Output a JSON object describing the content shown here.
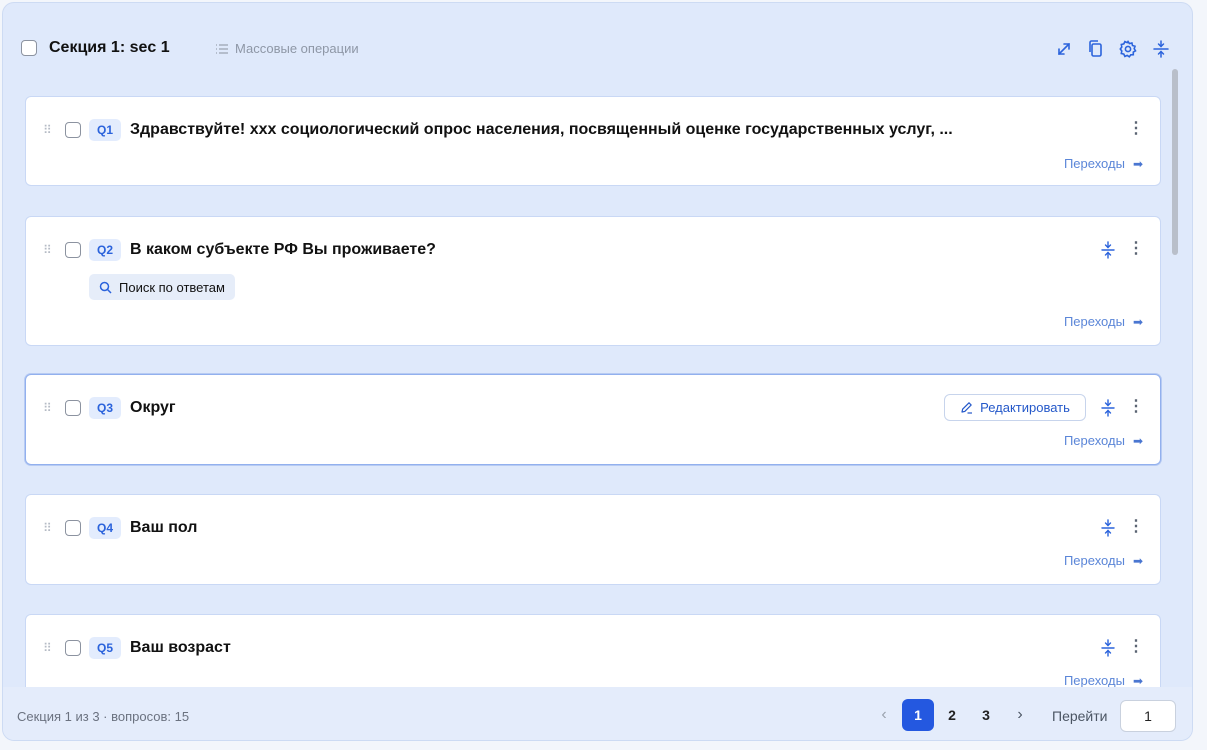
{
  "section": {
    "title": "Секция 1: sec 1",
    "bulk_label": "Массовые операции",
    "header_icons": [
      "expand-icon",
      "copy-icon",
      "settings-icon",
      "collapse-icon"
    ]
  },
  "questions": [
    {
      "tag": "Q1",
      "title": "Здравствуйте! ххх социологический опрос населения, посвященный оценке государственных услуг, ...",
      "transitions": "Переходы"
    },
    {
      "tag": "Q2",
      "title": "В каком субъекте РФ Вы проживаете?",
      "search_label": "Поиск по ответам",
      "transitions": "Переходы"
    },
    {
      "tag": "Q3",
      "title": "Округ",
      "edit_label": "Редактировать",
      "transitions": "Переходы"
    },
    {
      "tag": "Q4",
      "title": "Ваш пол",
      "transitions": "Переходы"
    },
    {
      "tag": "Q5",
      "title": "Ваш возраст",
      "transitions": "Переходы"
    }
  ],
  "footer": {
    "info": "Секция 1 из 3 · вопросов: 15",
    "pages": [
      "1",
      "2",
      "3"
    ],
    "current_page": "1",
    "goto_label": "Перейти",
    "goto_value": "1"
  },
  "colors": {
    "accent": "#2458e0",
    "section_bg": "#dfe9fb"
  }
}
